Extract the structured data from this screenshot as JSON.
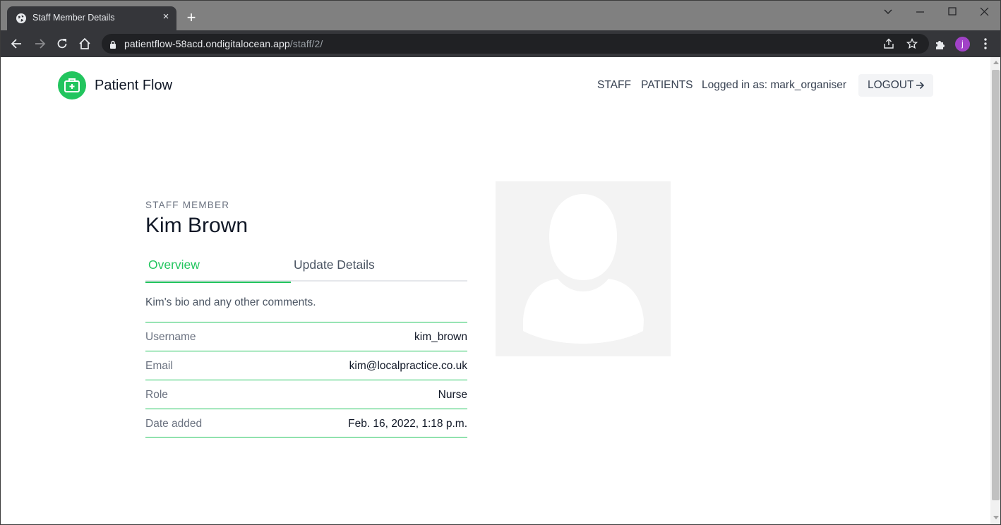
{
  "browser": {
    "tab_title": "Staff Member Details",
    "new_tab": "+",
    "close_tab": "×",
    "url_host": "patientflow-58acd.ondigitalocean.app",
    "url_path": "/staff/2/",
    "profile_initial": "j"
  },
  "header": {
    "brand": "Patient Flow",
    "nav": [
      "STAFF",
      "PATIENTS"
    ],
    "logged_in": "Logged in as: mark_organiser",
    "logout_label": "LOGOUT"
  },
  "staff": {
    "eyebrow": "STAFF MEMBER",
    "name": "Kim Brown",
    "tabs": [
      {
        "label": "Overview",
        "active": true
      },
      {
        "label": "Update Details",
        "active": false
      }
    ],
    "bio": "Kim's bio and any other comments.",
    "fields": [
      {
        "label": "Username",
        "value": "kim_brown"
      },
      {
        "label": "Email",
        "value": "kim@localpractice.co.uk"
      },
      {
        "label": "Role",
        "value": "Nurse"
      },
      {
        "label": "Date added",
        "value": "Feb. 16, 2022, 1:18 p.m."
      }
    ]
  },
  "colors": {
    "accent": "#22c55e",
    "chrome_dark": "#35363a",
    "titlebar": "#808080",
    "avatar_bg": "#f3f3f3"
  },
  "icons": {
    "tab": "globe-icon",
    "logo": "medical-kit-icon",
    "logout": "arrow-right-icon",
    "avatar": "person-silhouette-icon"
  }
}
